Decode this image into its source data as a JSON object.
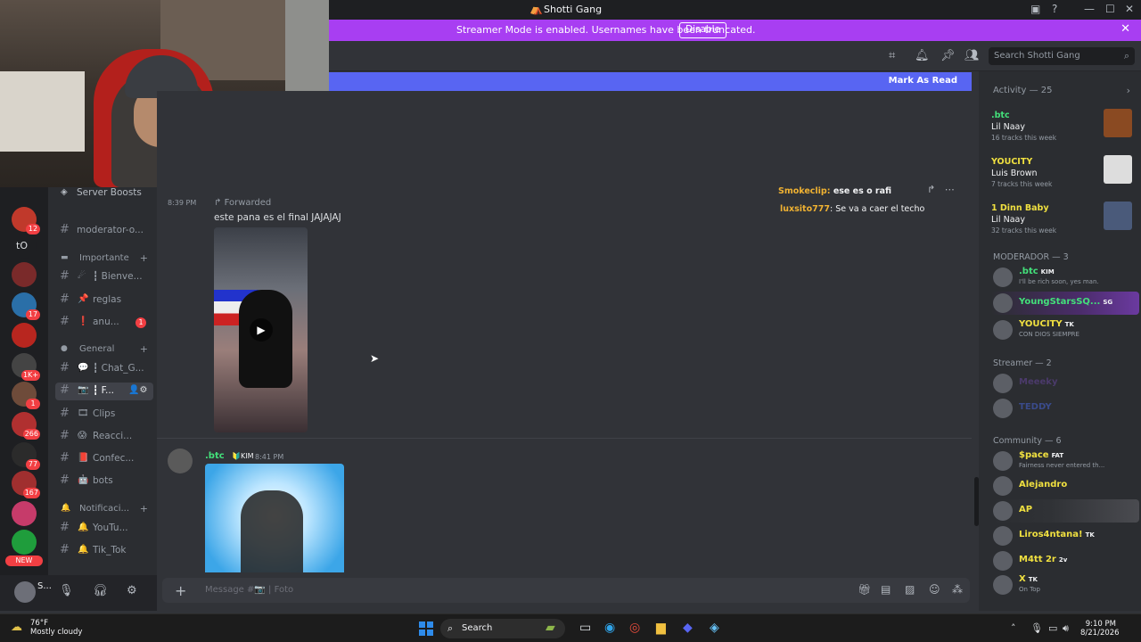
{
  "window": {
    "title": "Shotti Gang"
  },
  "banner": {
    "message": "Streamer Mode is enabled. Usernames have been truncated.",
    "disable_label": "Disable"
  },
  "header": {
    "search_placeholder": "Search Shotti Gang"
  },
  "new_messages_bar": {
    "mark_as_read": "Mark As Read"
  },
  "servers": {
    "items": [
      {
        "text": "",
        "badge": "12",
        "color": "#c0392b"
      },
      {
        "text": "tO",
        "badge": "",
        "color": "#1e1f22"
      },
      {
        "text": "",
        "badge": "",
        "color": "#7a2a2a"
      },
      {
        "text": "",
        "badge": "17",
        "color": "#2a6fa8"
      },
      {
        "text": "",
        "badge": "",
        "color": "#b8261f"
      },
      {
        "text": "",
        "badge": "1K+",
        "color": "#444"
      },
      {
        "text": "",
        "badge": "1",
        "color": "#6e4b3a"
      },
      {
        "text": "",
        "badge": "266",
        "color": "#b03030"
      },
      {
        "text": "",
        "badge": "77",
        "color": "#2b2b2b"
      },
      {
        "text": "",
        "badge": "167",
        "color": "#a02f2f"
      },
      {
        "text": "",
        "badge": "",
        "color": "#c63b6a"
      },
      {
        "text": "",
        "badge": "",
        "color": "#1f9d3c"
      }
    ],
    "new_label": "NEW"
  },
  "channels": {
    "server_boosts": "Server Boosts",
    "items": [
      {
        "type": "channel",
        "label": "moderator-o...",
        "emoji": ""
      },
      {
        "type": "category",
        "label": "Importante",
        "emoji": "▬"
      },
      {
        "type": "channel",
        "label": "┇ Bienve...",
        "emoji": "☄"
      },
      {
        "type": "channel",
        "label": "reglas",
        "emoji": "📌"
      },
      {
        "type": "channel",
        "label": "anu...",
        "emoji": "❗",
        "unread": "1"
      },
      {
        "type": "category",
        "label": "General",
        "emoji": "●"
      },
      {
        "type": "channel",
        "label": "┇ Chat_G...",
        "emoji": "💬"
      },
      {
        "type": "channel",
        "label": "┇ F...",
        "emoji": "📷",
        "active": true
      },
      {
        "type": "channel",
        "label": "Clips",
        "emoji": "🎞"
      },
      {
        "type": "channel",
        "label": "Reacci...",
        "emoji": "😱"
      },
      {
        "type": "channel",
        "label": "Confec...",
        "emoji": "📕"
      },
      {
        "type": "channel",
        "label": "bots",
        "emoji": "🤖"
      },
      {
        "type": "category",
        "label": "Notificaci...",
        "emoji": "🔔"
      },
      {
        "type": "channel",
        "label": "YouTu...",
        "emoji": "🔔"
      },
      {
        "type": "channel",
        "label": "Tik_Tok",
        "emoji": "🔔"
      }
    ]
  },
  "user_panel": {
    "name": "S..."
  },
  "messages": {
    "time_1": "8:39 PM",
    "forwarded": "Forwarded",
    "text_1": "este pana es el final JAJAJAJ",
    "author_2": ".btc",
    "tag_2": "KIM",
    "time_2": "8:41 PM"
  },
  "overlay_chat": {
    "line1_user": "Smokeclip",
    "line1_text": "ese es o rafi",
    "line2_user": "luxsito777",
    "line2_text": ": Se va a caer el techo"
  },
  "composer": {
    "placeholder": "Message #📷 | Foto"
  },
  "members": {
    "activity_header": "Activity — 25",
    "activity": [
      {
        "name": ".btc",
        "name_color": "#43e07a",
        "song": "Lil Naay",
        "tracks": "16 tracks this week",
        "thumb": "#8a4a22"
      },
      {
        "name": "YOUCITY",
        "name_color": "#f0e040",
        "song": "Luis Brown",
        "tracks": "7 tracks this week",
        "thumb": "#dddddd"
      },
      {
        "name": "1 Dinn Baby",
        "name_color": "#f0e040",
        "song": "Lil Naay",
        "tracks": "32 tracks this week",
        "thumb": "#4a5a7a"
      }
    ],
    "moderador_header": "MODERADOR — 3",
    "moderadores": [
      {
        "name": ".btc",
        "badge": "KIM",
        "sub": "I'll be rich soon, yes man.",
        "color": "#43e07a"
      },
      {
        "name": "YoungStarsSQ...",
        "badge": "SG",
        "sub": "",
        "color": "#43e07a",
        "hl": true
      },
      {
        "name": "YOUCITY",
        "badge": "TK",
        "sub": "CON DIOS SIEMPRE",
        "color": "#f0e040"
      }
    ],
    "streamer_header": "Streamer — 2",
    "streamers": [
      {
        "name": "Meeeky",
        "color": "#4b3a6b"
      },
      {
        "name": "TEDDY",
        "color": "#3a4b8b"
      }
    ],
    "community_header": "Community — 6",
    "community": [
      {
        "name": "$pace",
        "badge": "FAT",
        "sub": "Fairness never entered th...",
        "color": "#f0e040"
      },
      {
        "name": "Alejandro",
        "badge": "",
        "sub": "",
        "color": "#f0e040"
      },
      {
        "name": "AP",
        "badge": "",
        "sub": "",
        "color": "#f0e040",
        "dark": true
      },
      {
        "name": "Liros4ntana!",
        "badge": "TK",
        "sub": "",
        "color": "#f0e040"
      },
      {
        "name": "M4tt 2r",
        "badge": "2v",
        "sub": "",
        "color": "#f0e040"
      },
      {
        "name": "X",
        "badge": "TK",
        "sub": "On Top",
        "color": "#f0e040"
      }
    ]
  },
  "taskbar": {
    "temp": "76°F",
    "weather": "Mostly cloudy",
    "search_label": "Search",
    "time": "9:10 PM",
    "date": "8/21/2026"
  }
}
